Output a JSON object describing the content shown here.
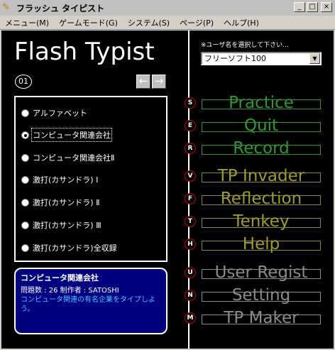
{
  "window": {
    "title": "フラッシュ タイピスト",
    "icon": "pencil-icon"
  },
  "window_buttons": [
    "_",
    "□",
    "×"
  ],
  "menubar": [
    "メニュー(M)",
    "ゲームモード(G)",
    "システム(S)",
    "ページ(P)",
    "ヘルプ(H)"
  ],
  "app_title": "Flash Typist",
  "page": {
    "number": "01",
    "prev": "←",
    "next": "→"
  },
  "list": [
    {
      "label": "アルファベット",
      "checked": false
    },
    {
      "label": "コンピュータ関連会社",
      "checked": true
    },
    {
      "label": "コンピュータ関連会社Ⅱ",
      "checked": false
    },
    {
      "label": "激打(カサンドラ) Ⅰ",
      "checked": false
    },
    {
      "label": "激打(カサンドラ) Ⅱ",
      "checked": false
    },
    {
      "label": "激打(カサンドラ) Ⅲ",
      "checked": false
    },
    {
      "label": "激打(カサンドラ)全収録",
      "checked": false
    }
  ],
  "info": {
    "title": "コンピュータ関連会社",
    "meta": "問題数 : 26    制作者 : SATOSHI",
    "description": "コンピュータ関連の有名企業をタイプしよう。"
  },
  "user_select": {
    "hint": "※ユーザ名を選択して下さい...",
    "value": "フリーソフト100"
  },
  "actions": [
    {
      "key": "S",
      "label": "Practice",
      "group": "g1"
    },
    {
      "key": "E",
      "label": "Quit",
      "group": "g1"
    },
    {
      "key": "R",
      "label": "Record",
      "group": "g1"
    },
    {
      "key": "V",
      "label": "TP Invader",
      "group": "g2"
    },
    {
      "key": "F",
      "label": "Reflection",
      "group": "g2"
    },
    {
      "key": "T",
      "label": "Tenkey",
      "group": "g2"
    },
    {
      "key": "H",
      "label": "Help",
      "group": "g2"
    },
    {
      "key": "U",
      "label": "User Regist",
      "group": "g3"
    },
    {
      "key": "N",
      "label": "Setting",
      "group": "g3"
    },
    {
      "key": "M",
      "label": "TP Maker",
      "group": "g3"
    }
  ],
  "colors": {
    "practice_group": "#2e9a2e",
    "game_group": "#9c9c30",
    "system_group": "#8a8a8a",
    "info_bg": "#000080",
    "info_text": "#4fc3f7"
  }
}
